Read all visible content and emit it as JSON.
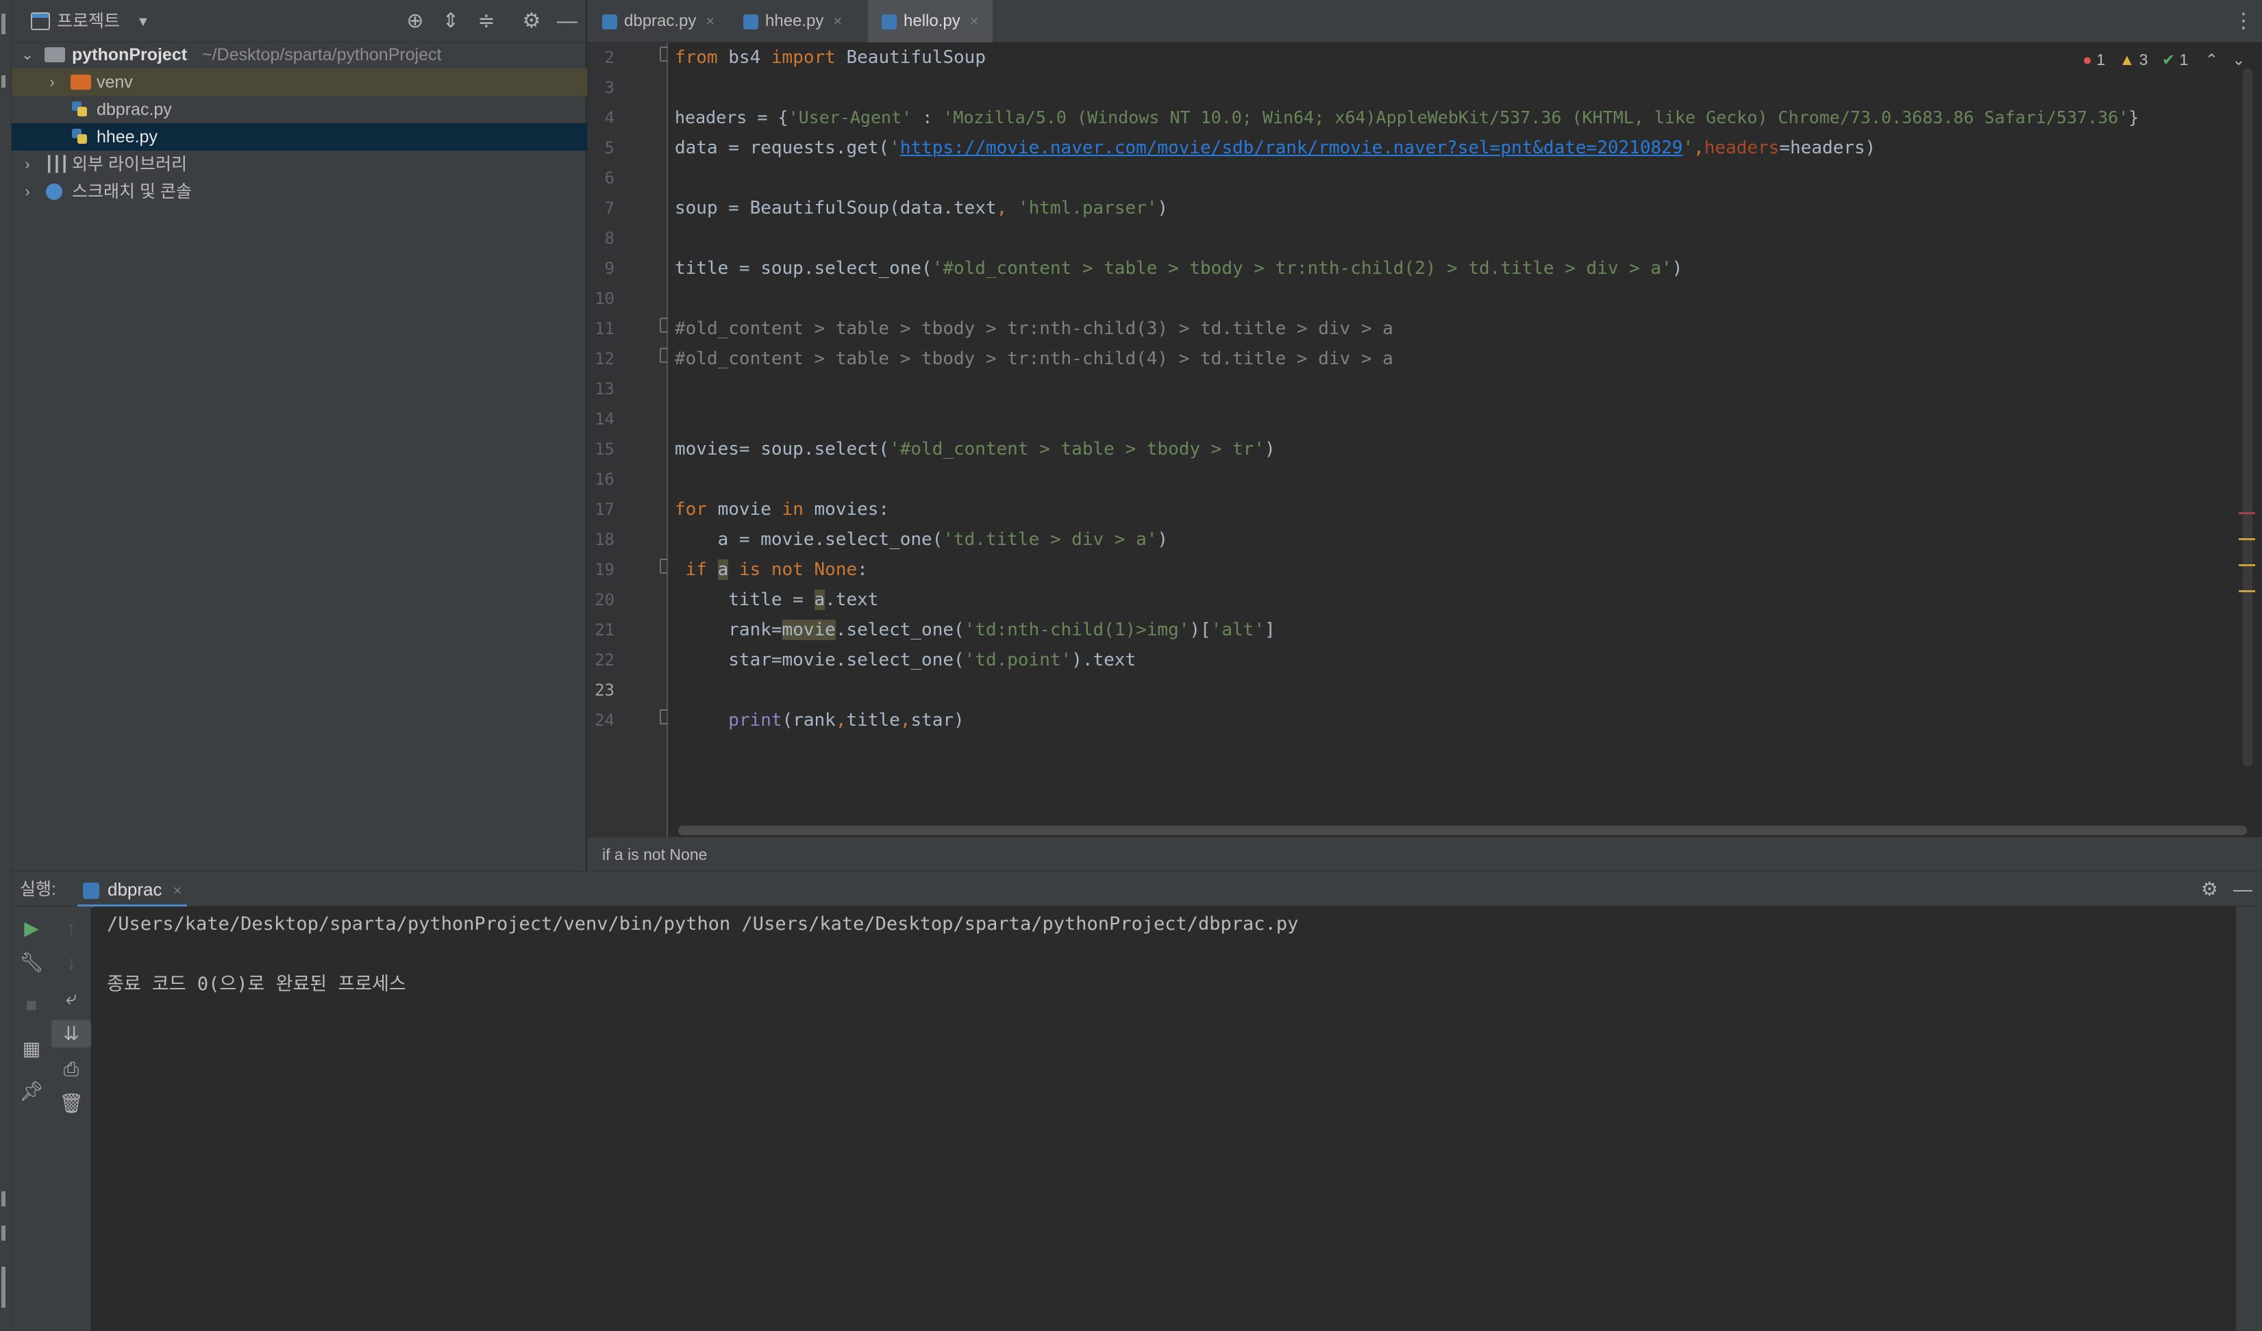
{
  "project_panel": {
    "title": "프로젝트",
    "tree": [
      {
        "label": "pythonProject",
        "path": "~/Desktop/sparta/pythonProject"
      },
      {
        "label": "venv"
      },
      {
        "label": "dbprac.py"
      },
      {
        "label": "hhee.py"
      },
      {
        "label": "외부 라이브러리"
      },
      {
        "label": "스크래치 및 콘솔"
      }
    ]
  },
  "tabs": [
    {
      "label": "dbprac.py",
      "active": false
    },
    {
      "label": "hhee.py",
      "active": false
    },
    {
      "label": "hello.py",
      "active": true
    }
  ],
  "inspections": {
    "errors": "1",
    "warnings": "3",
    "ok": "1"
  },
  "editor": {
    "line_numbers": [
      "2",
      "3",
      "4",
      "5",
      "6",
      "7",
      "8",
      "9",
      "10",
      "11",
      "12",
      "13",
      "14",
      "15",
      "16",
      "17",
      "18",
      "19",
      "20",
      "21",
      "22",
      "23",
      "24"
    ],
    "current_line": "23",
    "lines": {
      "l2": {
        "kw_from": "from",
        "mod": " bs4 ",
        "kw_import": "import",
        "name": " BeautifulSoup"
      },
      "l4": {
        "p1": "headers = {",
        "s1": "'User-Agent'",
        "p2": " : ",
        "s2": "'Mozilla/5.0 (Windows NT 10.0; Win64; x64)AppleWebKit/537.36 (KHTML, like Gecko) Chrome/73.0.3683.86 Safari/537.36'",
        "p3": "}"
      },
      "l5": {
        "p1": "data = requests.get(",
        "q1": "'",
        "url": "https://movie.naver.com/movie/sdb/rank/rmovie.naver?sel=pnt&date=20210829",
        "q2": "'",
        "comma": ",",
        "param": "headers",
        "p2": "=headers)"
      },
      "l7": {
        "p1": "soup = BeautifulSoup(data.text",
        "comma": ", ",
        "s1": "'html.parser'",
        "p2": ")"
      },
      "l9": {
        "p1": "title = soup.select_one(",
        "s1": "'#old_content > table > tbody > tr:nth-child(2) > td.title > div > a'",
        "p2": ")"
      },
      "l11": {
        "c": "#old_content > table > tbody > tr:nth-child(3) > td.title > div > a"
      },
      "l12": {
        "c": "#old_content > table > tbody > tr:nth-child(4) > td.title > div > a"
      },
      "l15": {
        "p1": "movies= soup.select(",
        "s1": "'#old_content > table > tbody > tr'",
        "p2": ")"
      },
      "l17": {
        "kw_for": "for",
        "p1": " movie ",
        "kw_in": "in",
        "p2": " movies:"
      },
      "l18": {
        "p1": "    a = movie.select_one(",
        "s1": "'td.title > div > a'",
        "p2": ")"
      },
      "l19": {
        "indent": " ",
        "kw_if": "if",
        "sp": " ",
        "a": "a",
        "sp2": " ",
        "kw_is": "is",
        "sp3": " ",
        "kw_not": "not",
        "sp4": " ",
        "kw_none": "None",
        "p2": ":"
      },
      "l20": {
        "p1": "     title = ",
        "a": "a",
        "p2": ".text"
      },
      "l21": {
        "p1": "     rank=",
        "movie": "movie",
        "p2": ".select_one(",
        "s1": "'td:nth-child(1)>img'",
        "p3": ")[",
        "s2": "'alt'",
        "p4": "]"
      },
      "l22": {
        "p1": "     star=movie.select_one(",
        "s1": "'td.point'",
        "p2": ").text"
      },
      "l24": {
        "indent": "     ",
        "print": "print",
        "p1": "(rank",
        "c1": ",",
        "p2": "title",
        "c2": ",",
        "p3": "star)"
      }
    }
  },
  "breadcrumb": "if a is not None",
  "run": {
    "label": "실행:",
    "tab": "dbprac",
    "output": [
      "/Users/kate/Desktop/sparta/pythonProject/venv/bin/python /Users/kate/Desktop/sparta/pythonProject/dbprac.py",
      "",
      "종료 코드 0(으)로 완료된 프로세스"
    ]
  }
}
